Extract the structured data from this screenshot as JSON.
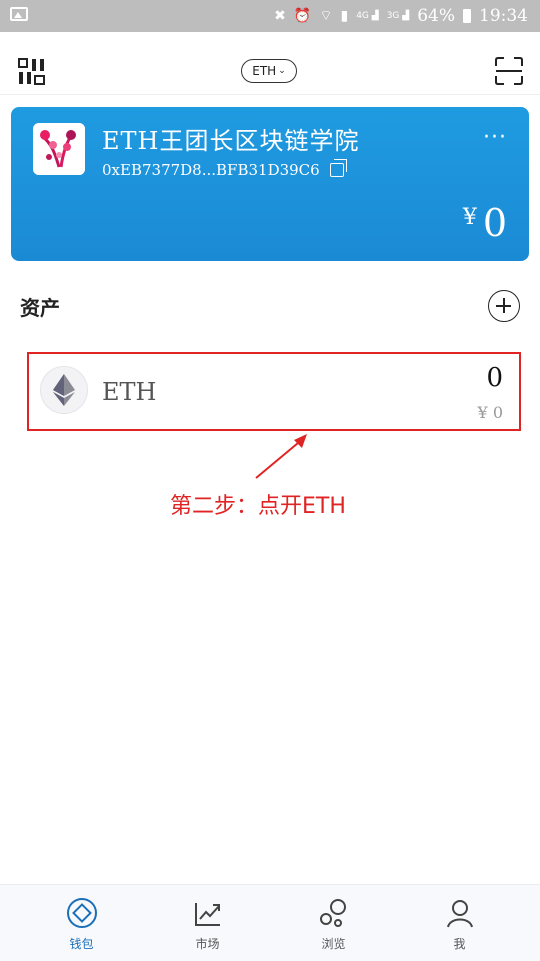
{
  "status_bar": {
    "battery_percent": "64%",
    "time": "19:34",
    "signal_4g": "4G",
    "signal_3g": "3G",
    "icons": [
      "image-icon",
      "mute-icon",
      "alarm-icon",
      "wifi-icon",
      "sim-icon",
      "signal-4g-icon",
      "signal-3g-icon",
      "battery-icon"
    ]
  },
  "topbar": {
    "network_label": "ETH",
    "left_icon": "grid-menu-icon",
    "right_icon": "scan-icon"
  },
  "wallet_card": {
    "name": "ETH王团长区块链学院",
    "address": "0xEB7377D8...BFB31D39C6",
    "currency_symbol": "¥",
    "balance": "0",
    "more_label": "···",
    "accent_color": "#1b8ad5"
  },
  "assets": {
    "title": "资产",
    "tokens": [
      {
        "symbol": "ETH",
        "quantity": "0",
        "fiat_value": "¥ 0"
      }
    ]
  },
  "annotation": {
    "text": "第二步：点开ETH",
    "color": "#e02424"
  },
  "tabbar": {
    "items": [
      {
        "label": "钱包",
        "icon": "wallet-icon",
        "active": true
      },
      {
        "label": "市场",
        "icon": "market-chart-icon",
        "active": false
      },
      {
        "label": "浏览",
        "icon": "browse-bubbles-icon",
        "active": false
      },
      {
        "label": "我",
        "icon": "profile-icon",
        "active": false
      }
    ]
  }
}
